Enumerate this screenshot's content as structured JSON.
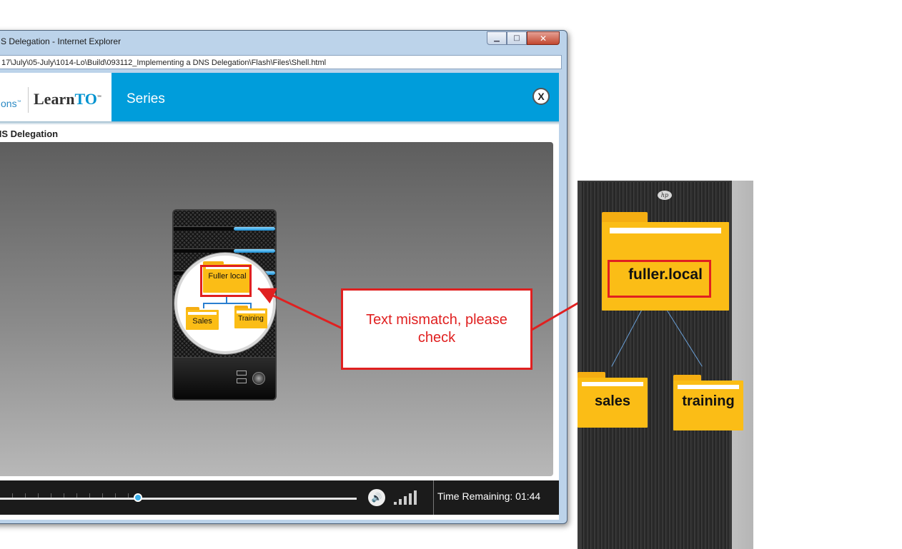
{
  "window": {
    "title": "S Delegation - Internet Explorer",
    "address": "17\\July\\05-July\\1014-Lo\\Build\\093112_Implementing a DNS Delegation\\Flash\\Files\\Shell.html",
    "minimize_icon": "minimize-icon",
    "maximize_icon": "maximize-icon",
    "close_icon": "close-icon"
  },
  "header": {
    "logo_partial": "ons",
    "logo_brand_prefix": "Learn",
    "logo_brand_suffix": "TO",
    "series_label": "Series",
    "close_label": "X",
    "accent_color": "#009ddb"
  },
  "lesson": {
    "title": "NS Delegation"
  },
  "stage": {
    "parent_folder": "Fuller local",
    "child_folders": [
      "Sales",
      "Training"
    ]
  },
  "annotation": {
    "text": "Text mismatch, please check",
    "color": "#e02020"
  },
  "controls": {
    "progress": 0.4,
    "volume_icon": "speaker-icon",
    "time_remaining": "Time Remaining: 01:44"
  },
  "reference": {
    "brand_logo": "hp",
    "parent_folder": "fuller.local",
    "child_folders": [
      "sales",
      "training"
    ]
  }
}
